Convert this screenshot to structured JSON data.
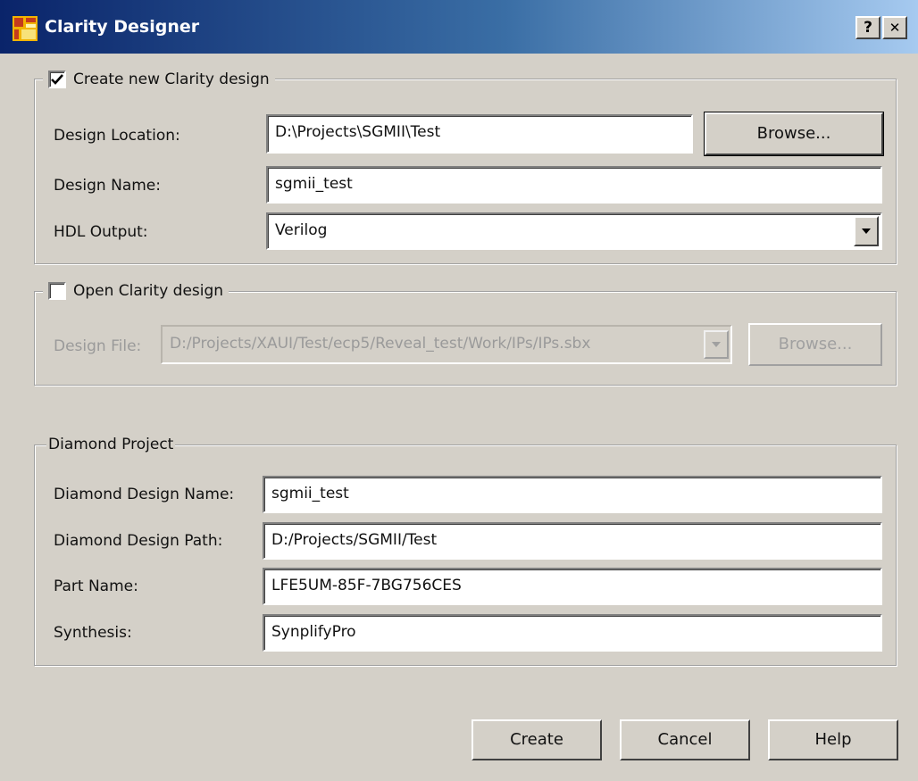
{
  "window": {
    "title": "Clarity Designer",
    "help_glyph": "?",
    "close_glyph": "✕"
  },
  "create_group": {
    "checkbox_label": "Create new Clarity design",
    "checked": true,
    "design_location_label": "Design Location:",
    "design_location_value": "D:\\Projects\\SGMII\\Test",
    "browse_label": "Browse...",
    "design_name_label": "Design Name:",
    "design_name_value": "sgmii_test",
    "hdl_output_label": "HDL Output:",
    "hdl_output_value": "Verilog"
  },
  "open_group": {
    "checkbox_label": "Open Clarity design",
    "checked": false,
    "design_file_label": "Design File:",
    "design_file_value": "D:/Projects/XAUI/Test/ecp5/Reveal_test/Work/IPs/IPs.sbx",
    "browse_label": "Browse..."
  },
  "diamond_group": {
    "legend": "Diamond Project",
    "design_name_label": "Diamond Design Name:",
    "design_name_value": "sgmii_test",
    "design_path_label": "Diamond Design Path:",
    "design_path_value": "D:/Projects/SGMII/Test",
    "part_name_label": "Part Name:",
    "part_name_value": "LFE5UM-85F-7BG756CES",
    "synthesis_label": "Synthesis:",
    "synthesis_value": "SynplifyPro"
  },
  "buttons": {
    "create": "Create",
    "cancel": "Cancel",
    "help": "Help"
  },
  "colors": {
    "titlebar_start": "#0a246a",
    "titlebar_end": "#a6caf0",
    "dialog_bg": "#d4d0c8"
  }
}
